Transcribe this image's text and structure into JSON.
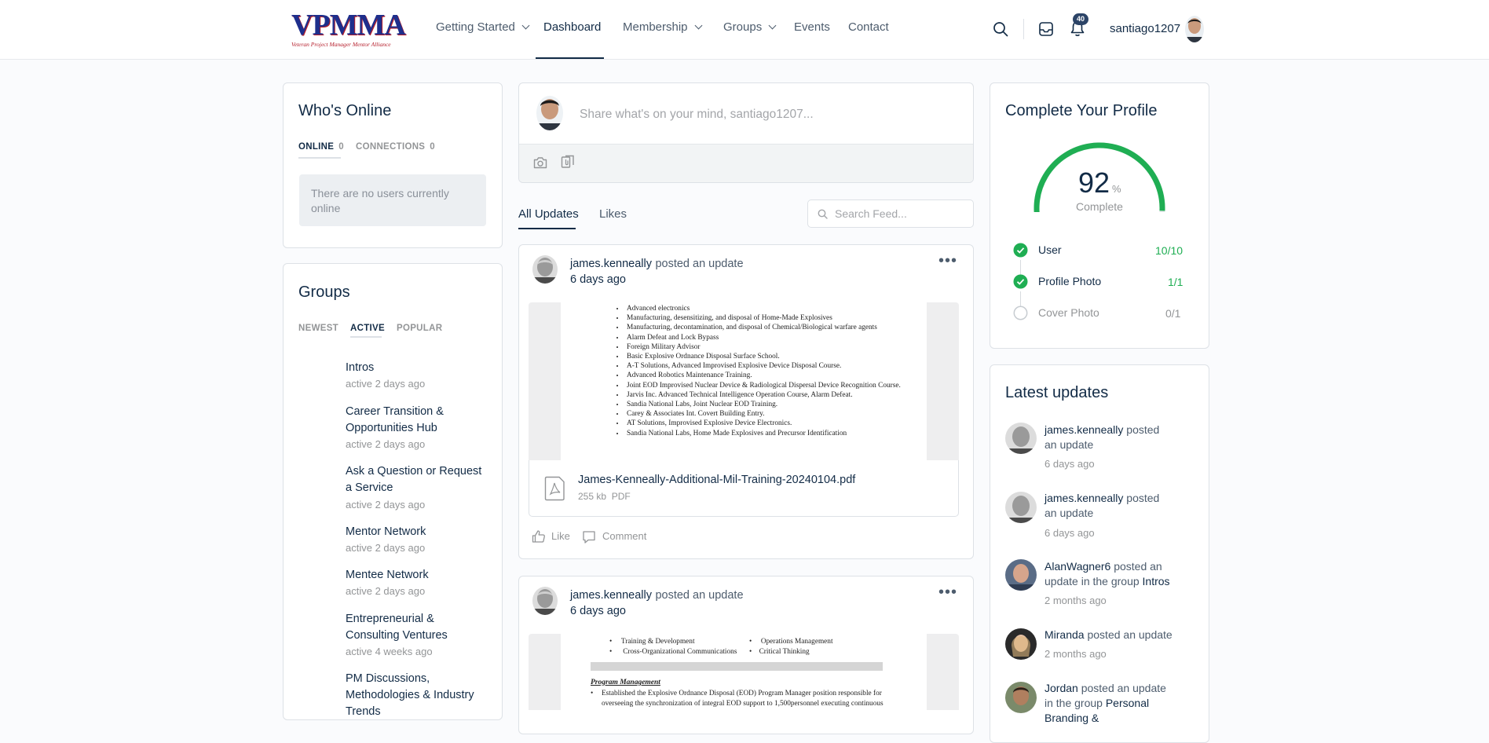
{
  "header": {
    "logo_text": "VPMMA",
    "logo_subtitle": "Veteran Project Manager Mentor Alliance",
    "nav": [
      {
        "label": "Getting Started"
      },
      {
        "label": "Dashboard"
      },
      {
        "label": "Membership"
      },
      {
        "label": "Groups"
      },
      {
        "label": "Events"
      },
      {
        "label": "Contact"
      }
    ],
    "notification_count": "40",
    "username": "santiago1207"
  },
  "whos_online": {
    "title": "Who's Online",
    "tabs": [
      {
        "label": "ONLINE",
        "count": "0"
      },
      {
        "label": "CONNECTIONS",
        "count": "0"
      }
    ],
    "empty_message": "There are no users currently online"
  },
  "groups": {
    "title": "Groups",
    "tabs": [
      "NEWEST",
      "ACTIVE",
      "POPULAR"
    ],
    "items": [
      {
        "name": "Intros",
        "meta": "active 2 days ago"
      },
      {
        "name": "Career Transition & Opportunities Hub",
        "meta": "active 2 days ago"
      },
      {
        "name": "Ask a Question or Request a Service",
        "meta": "active 2 days ago"
      },
      {
        "name": "Mentor Network",
        "meta": "active 2 days ago"
      },
      {
        "name": "Mentee Network",
        "meta": "active 2 days ago"
      },
      {
        "name": "Entrepreneurial & Consulting Ventures",
        "meta": "active 4 weeks ago"
      },
      {
        "name": "PM Discussions, Methodologies & Industry Trends",
        "meta": ""
      }
    ]
  },
  "composer": {
    "placeholder": "Share what's on your mind, santiago1207..."
  },
  "feed": {
    "tabs": [
      "All Updates",
      "Likes"
    ],
    "search_placeholder": "Search Feed...",
    "posts": [
      {
        "author": "james.kenneally",
        "action": "posted an update",
        "time": "6 days ago",
        "doc_lines": [
          "Advanced electronics",
          "Manufacturing, desensitizing, and disposal of Home-Made Explosives",
          "Manufacturing, decontamination, and disposal of Chemical/Biological warfare agents",
          "Alarm Defeat and Lock Bypass",
          "Foreign Military Advisor",
          "Basic Explosive Ordnance Disposal Surface School.",
          "A-T Solutions, Advanced Improvised Explosive Device Disposal Course.",
          "Advanced Robotics Maintenance Training.",
          "Joint EOD Improvised Nuclear Device & Radiological Dispersal Device Recognition Course.",
          "Jarvis Inc. Advanced Technical Intelligence Operation Course, Alarm Defeat.",
          "Sandia National Labs, Joint Nuclear EOD Training.",
          "Carey & Associates Int. Covert Building Entry.",
          "AT Solutions, Improvised Explosive Device Electronics.",
          "Sandia National Labs, Home Made Explosives and Precursor Identification"
        ],
        "file_name": "James-Kenneally-Additional-Mil-Training-20240104.pdf",
        "file_size": "255 kb",
        "file_type": "PDF",
        "like_label": "Like",
        "comment_label": "Comment"
      },
      {
        "author": "james.kenneally",
        "action": "posted an update",
        "time": "6 days ago",
        "doc_col1": [
          "Training & Development",
          "Cross-Organizational Communications"
        ],
        "doc_col2": [
          "Operations Management",
          "Critical Thinking"
        ],
        "doc_heading": "Program Management",
        "doc_line": "Established the Explosive Ordnance Disposal (EOD) Program Manager position responsible for overseeing the synchronization of integral EOD support to 1,500personnel executing continuous"
      }
    ]
  },
  "profile": {
    "title": "Complete Your Profile",
    "percent": "92",
    "percent_sign": "%",
    "percent_value": 92,
    "complete_label": "Complete",
    "items": [
      {
        "label": "User",
        "value": "10/10",
        "done": true
      },
      {
        "label": "Profile Photo",
        "value": "1/1",
        "done": true
      },
      {
        "label": "Cover Photo",
        "value": "0/1",
        "done": false
      }
    ],
    "accent": "#1fae53"
  },
  "latest": {
    "title": "Latest updates",
    "items": [
      {
        "name": "james.kenneally",
        "text": " posted an update",
        "group": "",
        "time": "6 days ago"
      },
      {
        "name": "james.kenneally",
        "text": " posted an update",
        "group": "",
        "time": "6 days ago"
      },
      {
        "name": "AlanWagner6",
        "text": " posted an update in the group ",
        "group": "Intros",
        "time": "2 months ago"
      },
      {
        "name": "Miranda",
        "text": " posted an update",
        "group": "",
        "time": "2 months ago"
      },
      {
        "name": "Jordan",
        "text": " posted an update in the group ",
        "group": "Personal Branding &",
        "time": ""
      }
    ]
  }
}
